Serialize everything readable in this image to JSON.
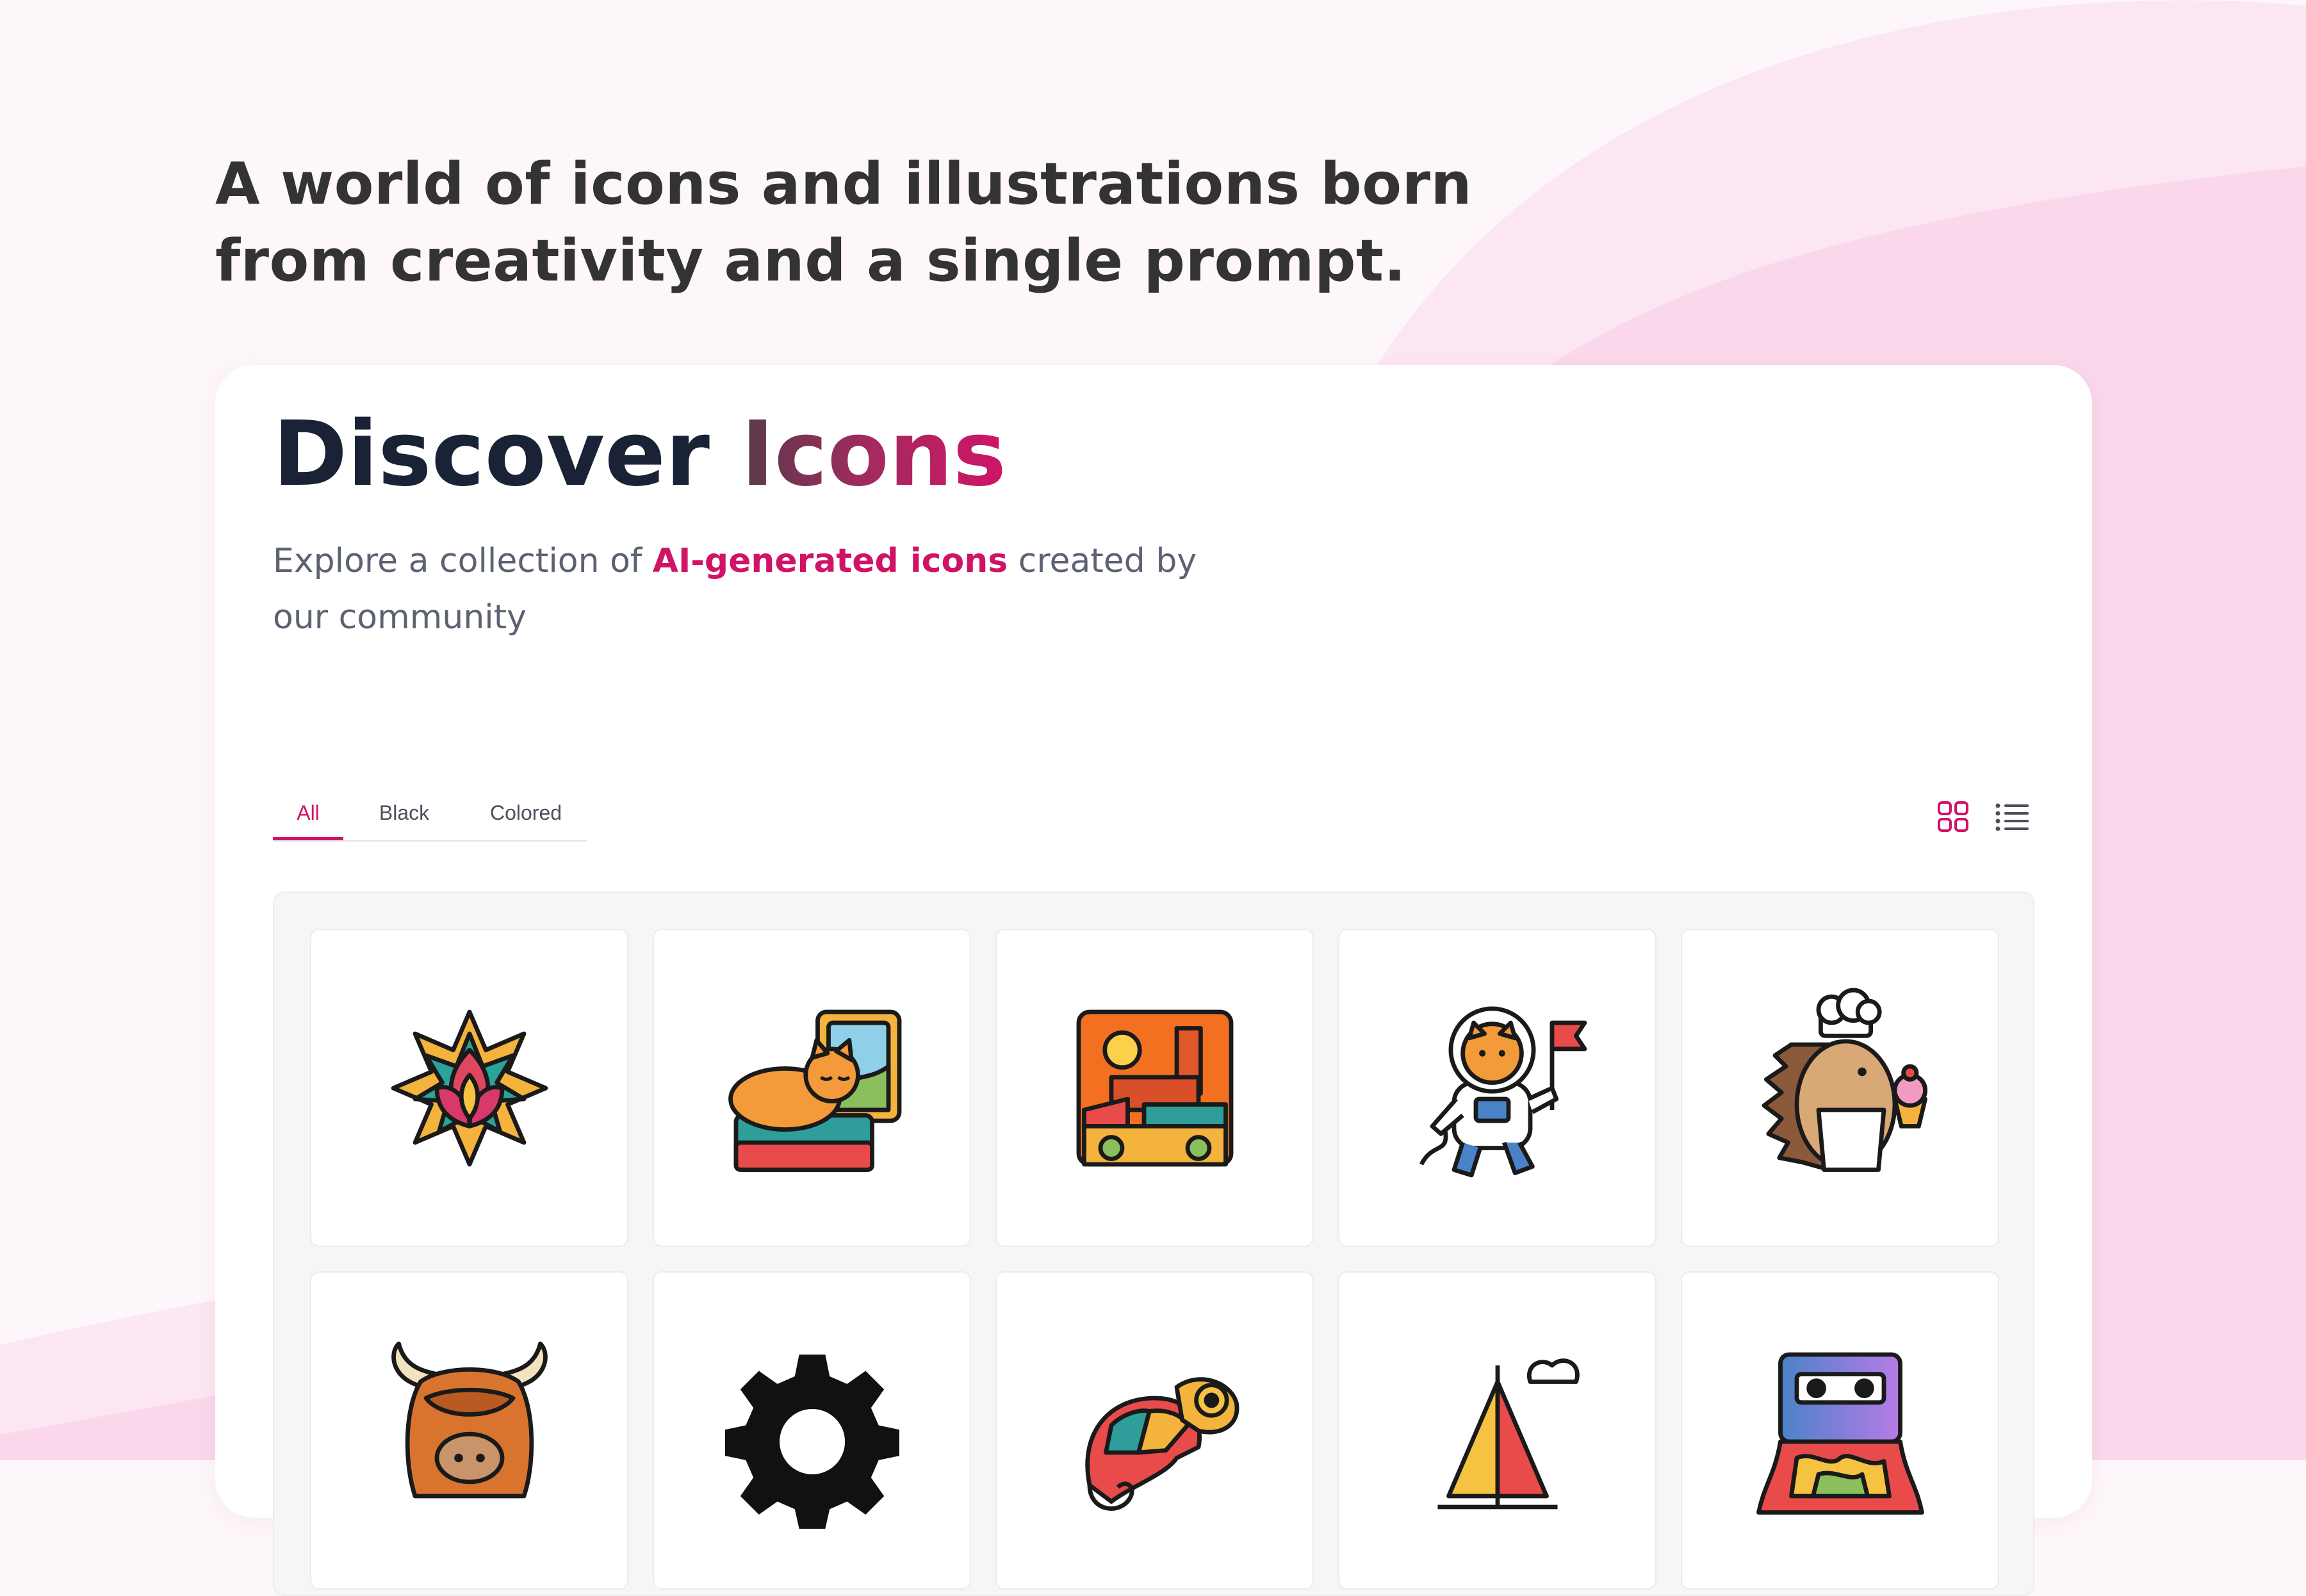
{
  "hero": {
    "headline_line1": "A world of icons and illustrations born",
    "headline_line2": "from creativity and a single prompt."
  },
  "discover": {
    "title_main": "Discover",
    "title_accent": "Icons",
    "subtitle_before": "Explore a collection of ",
    "subtitle_highlight": "AI-generated icons",
    "subtitle_after": " created by our community"
  },
  "filters": {
    "tabs": [
      "All",
      "Black",
      "Colored"
    ],
    "active": "All"
  },
  "view_modes": [
    "grid-icon",
    "list-icon"
  ],
  "active_view": "grid-icon",
  "gallery": {
    "items": [
      "lotus-mandala-icon",
      "cat-on-suitcase-icon",
      "market-town-icon",
      "astronaut-cat-icon",
      "chef-hedgehog-icon",
      "highland-cow-icon",
      "gear-icon",
      "chameleon-icon",
      "sailboat-icon",
      "melting-cassette-icon"
    ]
  },
  "colors": {
    "accent": "#cf1467",
    "headline": "#333333",
    "title": "#1a2236",
    "body_text": "#5c6272",
    "page_background": "#fdf6fa"
  }
}
